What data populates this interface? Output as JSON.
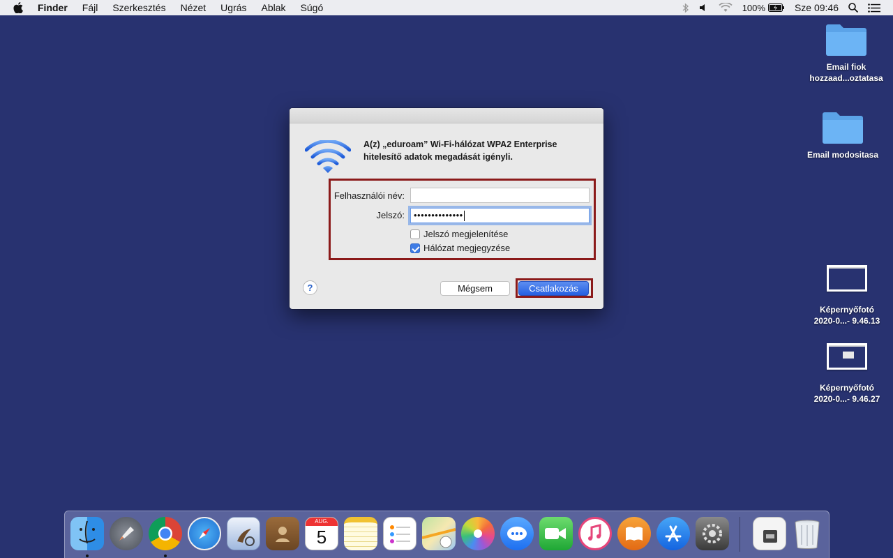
{
  "menubar": {
    "app_name": "Finder",
    "items": [
      "Fájl",
      "Szerkesztés",
      "Nézet",
      "Ugrás",
      "Ablak",
      "Súgó"
    ],
    "battery": "100%",
    "clock": "Sze 09:46"
  },
  "desktop": {
    "icons": [
      {
        "label_line1": "Email fiok",
        "label_line2": "hozzaad...oztatasa"
      },
      {
        "label_line1": "Email modositasa",
        "label_line2": ""
      },
      {
        "label_line1": "Képernyőfotó",
        "label_line2": "2020-0...- 9.46.13"
      },
      {
        "label_line1": "Képernyőfotó",
        "label_line2": "2020-0...- 9.46.27"
      }
    ]
  },
  "dialog": {
    "message_line1": "A(z) „eduroam” Wi-Fi-hálózat WPA2 Enterprise",
    "message_line2": "hitelesítő adatok megadását igényli.",
    "username_label": "Felhasználói név:",
    "username_value": "",
    "password_label": "Jelszó:",
    "password_value": "••••••••••••••",
    "show_password_label": "Jelszó megjelenítése",
    "show_password_checked": false,
    "remember_network_label": "Hálózat megjegyzése",
    "remember_network_checked": true,
    "help_label": "?",
    "cancel_label": "Mégsem",
    "connect_label": "Csatlakozás"
  },
  "dock": {
    "apps": [
      "finder-icon",
      "launchpad-icon",
      "chrome-icon",
      "safari-icon",
      "mail-icon",
      "contacts-icon",
      "calendar-icon",
      "notes-icon",
      "reminders-icon",
      "maps-icon",
      "photos-icon",
      "messages-icon",
      "facetime-icon",
      "itunes-icon",
      "ibooks-icon",
      "app-store-icon",
      "system-preferences-icon",
      "downloads-icon",
      "trash-icon"
    ],
    "calendar_month": "AUG.",
    "calendar_day": "5"
  },
  "colors": {
    "desktop": "#283270",
    "accent": "#2560e3",
    "highlight_frame": "#8b1a1a"
  }
}
